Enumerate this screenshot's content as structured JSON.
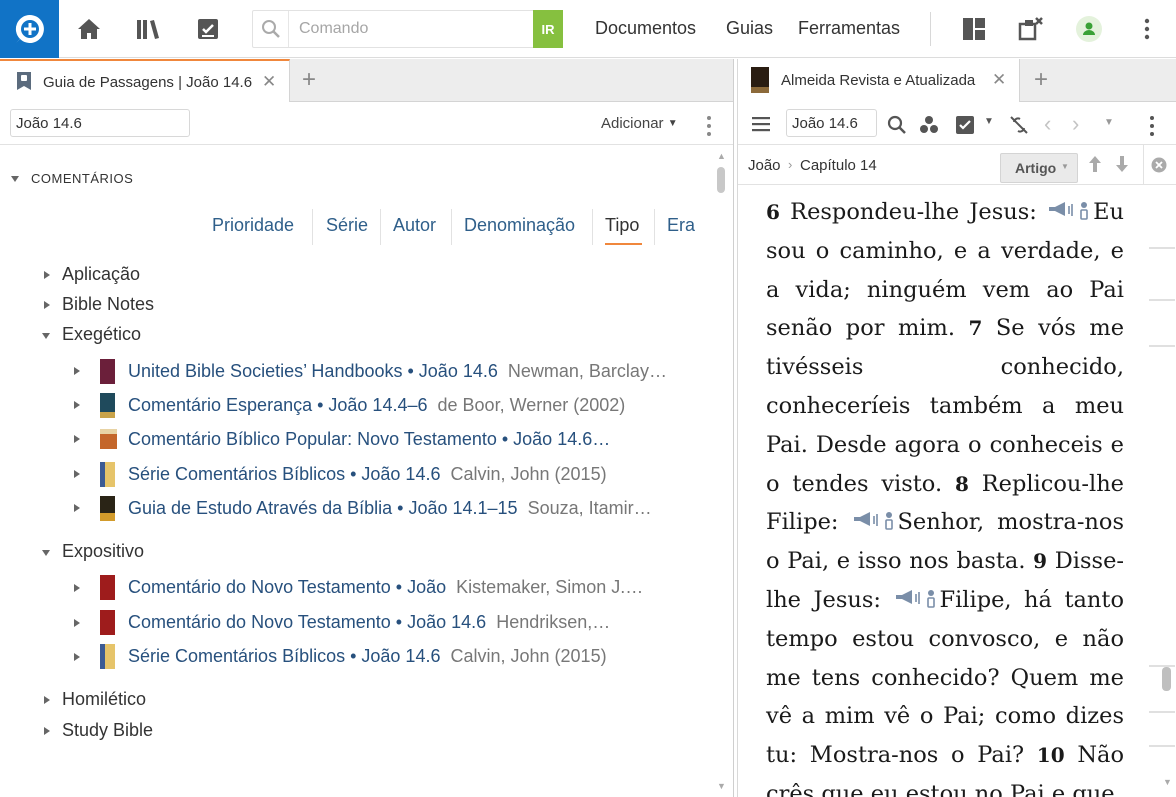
{
  "topbar": {
    "command_placeholder": "Comando",
    "go_label": "IR",
    "menu": [
      "Documentos",
      "Guias",
      "Ferramentas"
    ],
    "accent": "#1173c6",
    "go_color": "#86c03f"
  },
  "left": {
    "tab_title": "Guia de Passagens | João 14.6",
    "reference": "João 14.6",
    "add_label": "Adicionar",
    "section": "COMENTÁRIOS",
    "sort_tabs": [
      "Prioridade",
      "Série",
      "Autor",
      "Denominação",
      "Tipo",
      "Era"
    ],
    "active_sort": "Tipo",
    "groups": {
      "aplicacao": "Aplicação",
      "bible_notes": "Bible Notes",
      "exegetico": "Exegético",
      "expositivo": "Expositivo",
      "homiletico": "Homilético",
      "study_bible": "Study Bible"
    },
    "exegetico_items": [
      {
        "title": "United Bible Societies’ Handbooks • João 14.6",
        "author": "Newman, Barclay…"
      },
      {
        "title": "Comentário Esperança • João 14.4–6",
        "author": "de Boor, Werner (2002)"
      },
      {
        "title": "Comentário Bíblico Popular: Novo Testamento • João 14.6…",
        "author": ""
      },
      {
        "title": "Série Comentários Bíblicos • João 14.6",
        "author": "Calvin, John (2015)"
      },
      {
        "title": "Guia de Estudo Através da Bíblia • João 14.1–15",
        "author": "Souza, Itamir…"
      }
    ],
    "expositivo_items": [
      {
        "title": "Comentário do Novo Testamento • João",
        "author": "Kistemaker, Simon J.…"
      },
      {
        "title": "Comentário do Novo Testamento • João 14.6",
        "author": "Hendriksen,…"
      },
      {
        "title": "Série Comentários Bíblicos • João 14.6",
        "author": "Calvin, John (2015)"
      }
    ]
  },
  "right": {
    "tab_title": "Almeida Revista e Atualizada",
    "reference": "João 14.6",
    "crumb_book": "João",
    "crumb_chapter": "Capítulo 14",
    "artigo_label": "Artigo",
    "verses": {
      "v6": "6",
      "v6_a": "Respondeu-lhe Jesus:",
      "v6_b": "Eu sou o caminho, e a verdade, e a vida; ninguém vem ao Pai senão por mim.",
      "v7": "7",
      "v7_a": "Se vós me tivésseis conhecido, conheceríeis também a meu Pai. Desde agora o conheceis e o tendes visto.",
      "v8": "8",
      "v8_a": "Replicou-lhe Filipe:",
      "v8_b": "Senhor, mostra-nos o Pai, e isso nos basta.",
      "v9": "9",
      "v9_a": "Disse-lhe Jesus:",
      "v9_b": "Filipe, há tanto tempo estou convosco, e não me tens conhecido? Quem me vê a mim vê o Pai; como dizes tu: Mostra-nos o Pai?",
      "v10": "10",
      "v10_a": "Não crês que eu estou no Pai e que"
    }
  }
}
